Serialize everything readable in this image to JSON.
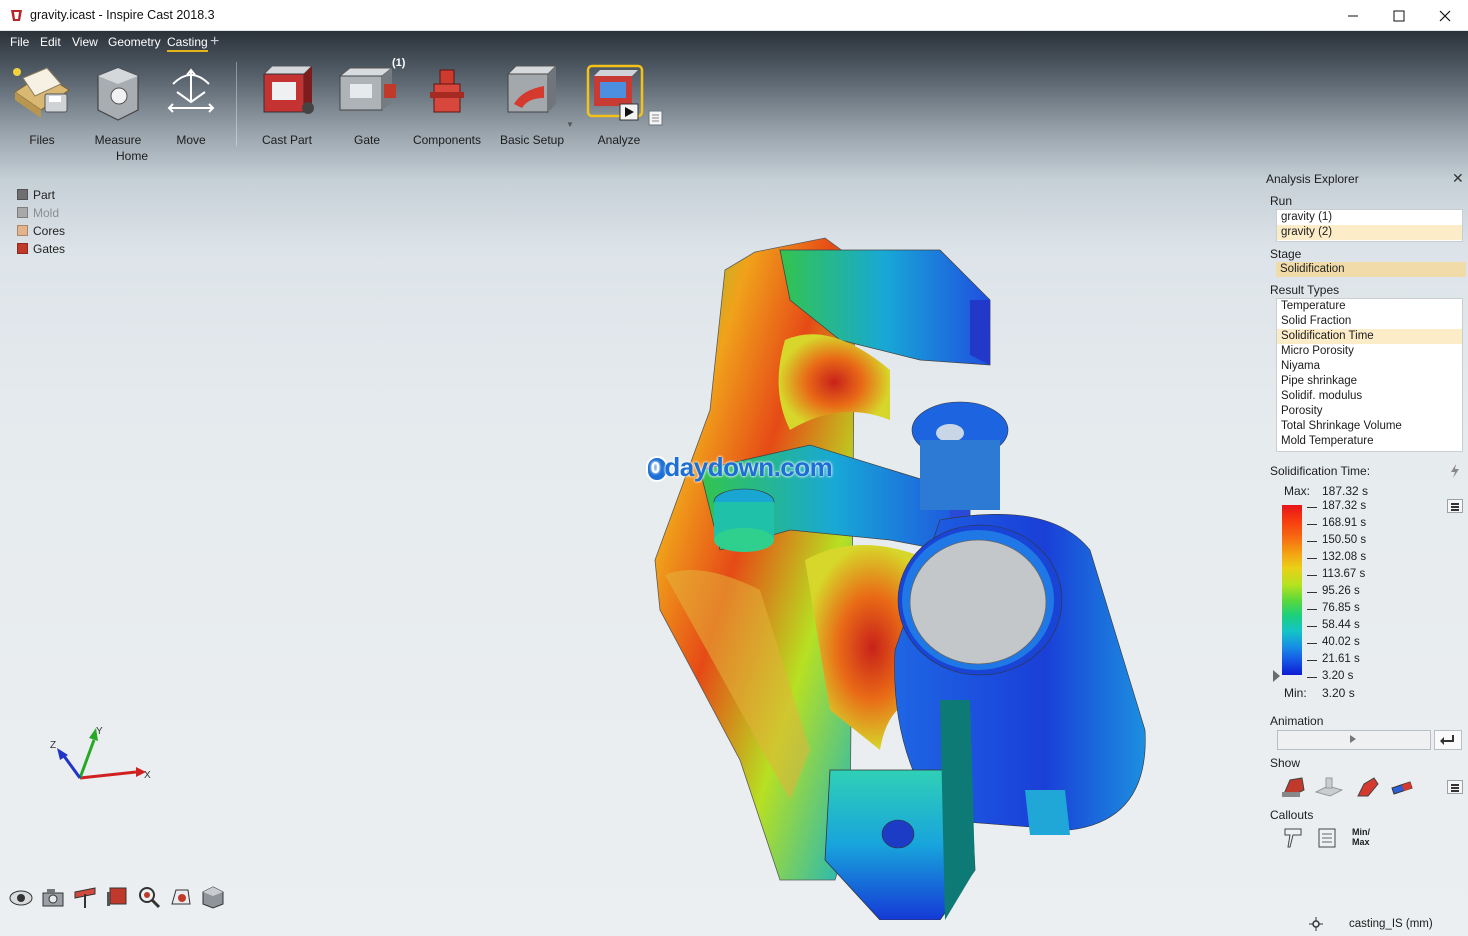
{
  "window": {
    "title": "gravity.icast - Inspire Cast 2018.3"
  },
  "menu": {
    "items": [
      {
        "label": "File",
        "active": false
      },
      {
        "label": "Edit",
        "active": false
      },
      {
        "label": "View",
        "active": false
      },
      {
        "label": "Geometry",
        "active": false
      },
      {
        "label": "Casting",
        "active": true
      }
    ],
    "add_label": "+"
  },
  "ribbon": {
    "files": "Files",
    "measure": "Measure",
    "home": "Home",
    "move": "Move",
    "cast_part": "Cast Part",
    "gate": "Gate",
    "gate_count": "(1)",
    "components": "Components",
    "basic_setup": "Basic Setup",
    "analyze": "Analyze"
  },
  "legend": {
    "items": [
      {
        "label": "Part",
        "color": "#6f6f6f",
        "dim": false
      },
      {
        "label": "Mold",
        "color": "#a8a8a8",
        "dim": true
      },
      {
        "label": "Cores",
        "color": "#e3b48c",
        "dim": false
      },
      {
        "label": "Gates",
        "color": "#c0392b",
        "dim": false
      }
    ]
  },
  "watermark": "daydown.com",
  "watermark_logo": "0",
  "triad": {
    "x": "X",
    "y": "Y",
    "z": "Z"
  },
  "analysis_explorer": {
    "title": "Analysis Explorer",
    "run_label": "Run",
    "runs": [
      {
        "label": "gravity (1)",
        "selected": false
      },
      {
        "label": "gravity (2)",
        "selected": true
      }
    ],
    "stage_label": "Stage",
    "stage_value": "Solidification",
    "result_types_label": "Result Types",
    "result_types": [
      {
        "label": "Temperature",
        "selected": false
      },
      {
        "label": "Solid Fraction",
        "selected": false
      },
      {
        "label": "Solidification Time",
        "selected": true
      },
      {
        "label": "Micro Porosity",
        "selected": false
      },
      {
        "label": "Niyama",
        "selected": false
      },
      {
        "label": "Pipe shrinkage",
        "selected": false
      },
      {
        "label": "Solidif. modulus",
        "selected": false
      },
      {
        "label": "Porosity",
        "selected": false
      },
      {
        "label": "Total Shrinkage Volume",
        "selected": false
      },
      {
        "label": "Mold Temperature",
        "selected": false
      }
    ],
    "scale": {
      "title": "Solidification Time:",
      "max_label": "Max:",
      "max_value": "187.32 s",
      "min_label": "Min:",
      "min_value": "3.20 s",
      "ticks": [
        "187.32 s",
        "168.91 s",
        "150.50 s",
        "132.08 s",
        "113.67 s",
        "95.26 s",
        "76.85 s",
        "58.44 s",
        "40.02 s",
        "21.61 s",
        "3.20 s"
      ]
    },
    "animation_label": "Animation",
    "show_label": "Show",
    "callouts_label": "Callouts",
    "minmax_label": "Min/\nMax"
  },
  "status": {
    "units": "casting_IS (mm)"
  },
  "colors": {
    "accent": "#e3b41a",
    "selection": "#fcecc8",
    "stage": "#f1dca9"
  }
}
